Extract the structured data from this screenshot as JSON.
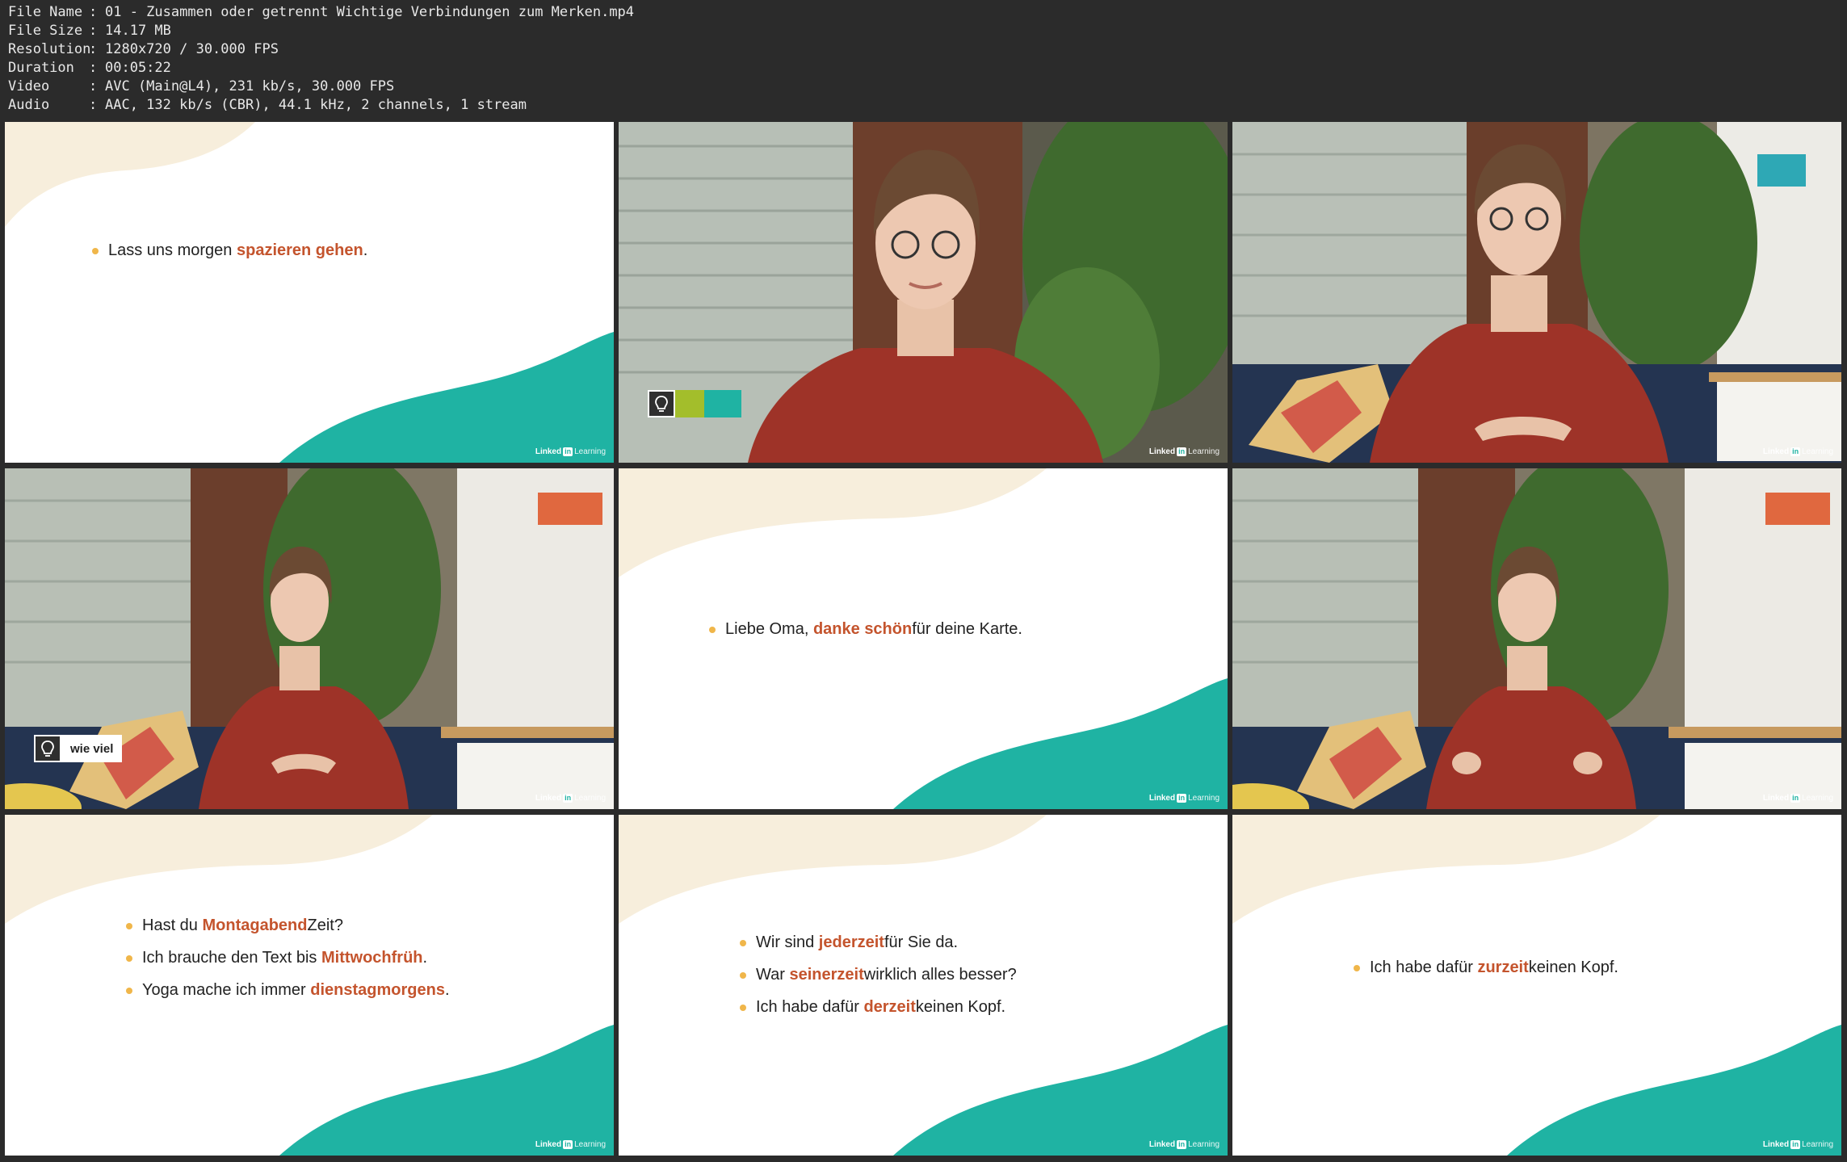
{
  "info": [
    {
      "key": "File Name",
      "value": "01 - Zusammen oder getrennt Wichtige Verbindungen zum Merken.mp4"
    },
    {
      "key": "File Size",
      "value": "14.17 MB"
    },
    {
      "key": "Resolution",
      "value": "1280x720 / 30.000 FPS"
    },
    {
      "key": "Duration",
      "value": "00:05:22"
    },
    {
      "key": "Video",
      "value": "AVC (Main@L4), 231 kb/s, 30.000 FPS"
    },
    {
      "key": "Audio",
      "value": "AAC, 132 kb/s (CBR), 44.1 kHz, 2 channels, 1 stream"
    }
  ],
  "colors": {
    "background": "#2b2b2b",
    "accent_teal": "#1fb3a3",
    "highlight": "#c4542d",
    "bullet": "#f0b64a",
    "cream": "#f7eedc",
    "lime": "#a3be2b"
  },
  "brand": {
    "linked": "Linked",
    "in": "in",
    "learning": "Learning"
  },
  "frames": {
    "f1": {
      "lines": [
        {
          "pre": "Lass uns morgen ",
          "hl": "spazieren gehen",
          "post": "."
        }
      ]
    },
    "f2": {
      "badge": "bulb-icon"
    },
    "f4": {
      "term": "wie viel"
    },
    "f5": {
      "lines": [
        {
          "pre": "Liebe Oma, ",
          "hl": "danke schön",
          "post": " für deine Karte."
        }
      ]
    },
    "f7": {
      "lines": [
        {
          "pre": "Hast du ",
          "hl": "Montagabend",
          "post": " Zeit?"
        },
        {
          "pre": "Ich brauche den Text bis ",
          "hl": "Mittwochfrüh",
          "post": "."
        },
        {
          "pre": "Yoga mache ich immer ",
          "hl": "dienstagmorgens",
          "post": "."
        }
      ]
    },
    "f8": {
      "lines": [
        {
          "pre": "Wir sind ",
          "hl": "jederzeit",
          "post": " für Sie da."
        },
        {
          "pre": "War ",
          "hl": "seinerzeit",
          "post": " wirklich alles besser?"
        },
        {
          "pre": "Ich habe dafür ",
          "hl": "derzeit",
          "post": " keinen Kopf."
        }
      ]
    },
    "f9": {
      "lines": [
        {
          "pre": "Ich habe dafür ",
          "hl": "zurzeit",
          "post": " keinen Kopf."
        }
      ]
    }
  }
}
